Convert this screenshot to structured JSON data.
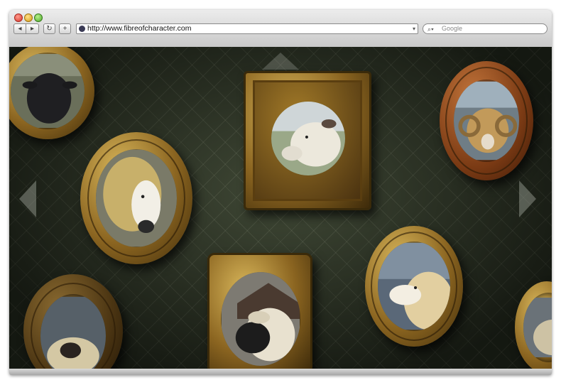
{
  "browser": {
    "address_url": "http://www.fibreofcharacter.com",
    "search_placeholder": "Google",
    "nav_back_glyph": "◂",
    "nav_forward_glyph": "▸",
    "reload_glyph": "↻",
    "add_glyph": "+",
    "dropdown_glyph": "▾",
    "search_glyph": "🔍"
  },
  "gallery": {
    "portraits": [
      {
        "id": "black-sheep-topleft",
        "icon": "black-sheep"
      },
      {
        "id": "curly-wool-sheep",
        "icon": "curly-sheep"
      },
      {
        "id": "white-sheep-center",
        "icon": "white-sheep"
      },
      {
        "id": "ram-horns",
        "icon": "ram"
      },
      {
        "id": "dark-ornate-bottomleft",
        "icon": "sheep"
      },
      {
        "id": "black-face-sheep",
        "icon": "black-face-sheep"
      },
      {
        "id": "white-sheep-profile",
        "icon": "white-sheep"
      },
      {
        "id": "partial-right",
        "icon": "sheep"
      }
    ]
  },
  "colors": {
    "wallpaper": "#2d3526",
    "gold": "#b8923e",
    "address_text": "#111111"
  }
}
